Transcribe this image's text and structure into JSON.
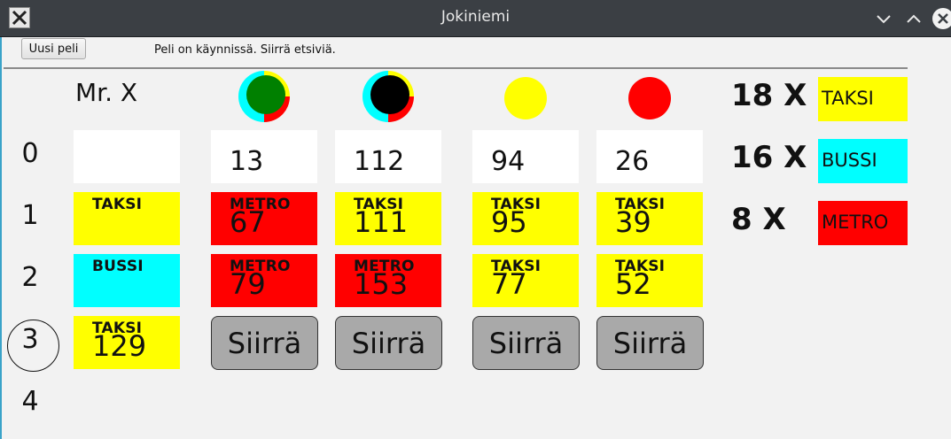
{
  "window": {
    "title": "Jokiniemi"
  },
  "toolbar": {
    "new_game_label": "Uusi peli",
    "status_text": "Peli on käynnissä. Siirrä etsiviä."
  },
  "players": [
    {
      "name": "Mr. X"
    },
    {
      "icon": "detective-green-token-icon",
      "color": "#008000"
    },
    {
      "icon": "detective-black-token-icon",
      "color": "#000000"
    },
    {
      "icon": "detective-yellow-token-icon",
      "color": "#ffff00"
    },
    {
      "icon": "detective-red-token-icon",
      "color": "#ff0000"
    }
  ],
  "rounds": [
    "0",
    "1",
    "2",
    "3",
    "4"
  ],
  "current_round": "3",
  "mrx_moves": [
    {
      "kind": "",
      "num": ""
    },
    {
      "kind": "TAKSI",
      "num": ""
    },
    {
      "kind": "BUSSI",
      "num": ""
    },
    {
      "kind": "TAKSI",
      "num": "129"
    }
  ],
  "detectives": [
    {
      "start": "13",
      "moves": [
        {
          "kind": "METRO",
          "num": "67"
        },
        {
          "kind": "METRO",
          "num": "79"
        }
      ],
      "button": "Siirrä"
    },
    {
      "start": "112",
      "moves": [
        {
          "kind": "TAKSI",
          "num": "111"
        },
        {
          "kind": "METRO",
          "num": "153"
        }
      ],
      "button": "Siirrä"
    },
    {
      "start": "94",
      "moves": [
        {
          "kind": "TAKSI",
          "num": "95"
        },
        {
          "kind": "TAKSI",
          "num": "77"
        }
      ],
      "button": "Siirrä"
    },
    {
      "start": "26",
      "moves": [
        {
          "kind": "TAKSI",
          "num": "39"
        },
        {
          "kind": "TAKSI",
          "num": "52"
        }
      ],
      "button": "Siirrä"
    }
  ],
  "tickets": [
    {
      "count": "18 X",
      "label": "TAKSI",
      "color": "#ffff00"
    },
    {
      "count": "16 X",
      "label": "BUSSI",
      "color": "#00ffff"
    },
    {
      "count": "8 X",
      "label": "METRO",
      "color": "#ff0000"
    }
  ],
  "colors": {
    "taksi": "#ffff00",
    "bussi": "#00ffff",
    "metro": "#ff0000",
    "button": "#a9a9a9"
  }
}
